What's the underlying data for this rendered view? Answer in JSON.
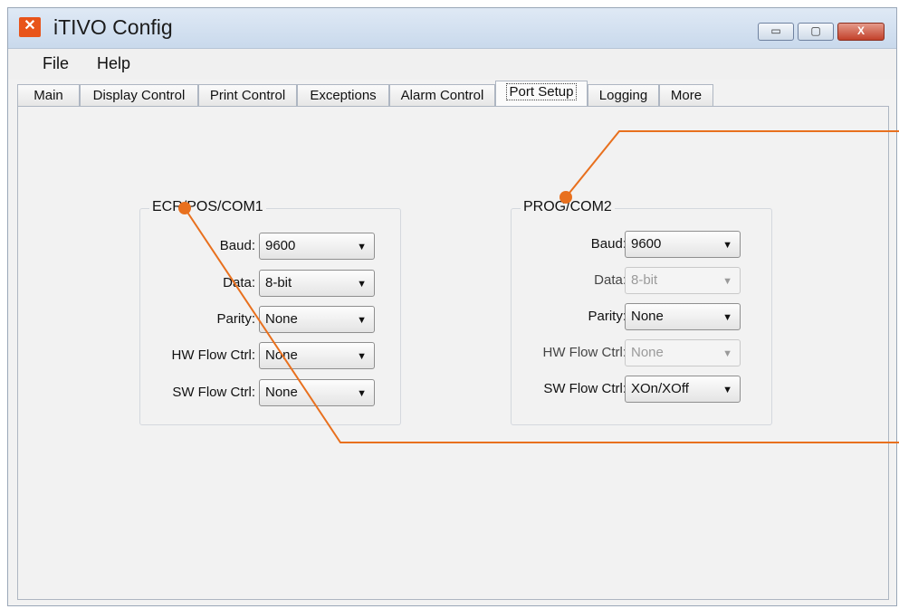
{
  "window": {
    "title": "iTIVO Config",
    "controls": {
      "minimize": "▭",
      "maximize": "▢",
      "close": "X"
    }
  },
  "menu": {
    "file": "File",
    "help": "Help"
  },
  "tabs": [
    "Main",
    "Display Control",
    "Print Control",
    "Exceptions",
    "Alarm Control",
    "Port Setup",
    "Logging",
    "More"
  ],
  "active_tab": "Port Setup",
  "com1": {
    "title": "ECR/POS/COM1",
    "rows": [
      {
        "label": "Baud:",
        "value": "9600"
      },
      {
        "label": "Data:",
        "value": "8-bit"
      },
      {
        "label": "Parity:",
        "value": "None"
      },
      {
        "label": "HW Flow Ctrl:",
        "value": "None"
      },
      {
        "label": "SW Flow Ctrl:",
        "value": "None"
      }
    ]
  },
  "com2": {
    "title": "PROG/COM2",
    "rows": [
      {
        "label": "Baud:",
        "value": "9600",
        "enabled": true
      },
      {
        "label": "Data:",
        "value": "8-bit",
        "enabled": false
      },
      {
        "label": "Parity:",
        "value": "None",
        "enabled": true
      },
      {
        "label": "HW Flow Ctrl:",
        "value": "None",
        "enabled": false
      },
      {
        "label": "SW Flow Ctrl:",
        "value": "XOn/XOff",
        "enabled": true
      }
    ]
  },
  "icons": {
    "dropdown": "chevron-down-icon",
    "app": "app-logo-icon"
  },
  "colors": {
    "annotation": "#e8701e",
    "close_button": "#c2412a"
  }
}
